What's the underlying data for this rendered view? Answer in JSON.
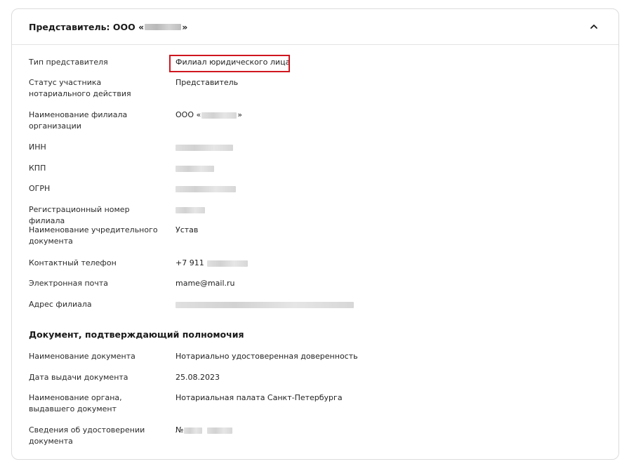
{
  "header": {
    "title_prefix": "Представитель: ООО «",
    "title_suffix": "»",
    "collapse_icon": "chevron-up-icon"
  },
  "representative": {
    "type_label": "Тип представителя",
    "type_value": "Филиал юридического лица",
    "status_label": "Статус участника нотариального действия",
    "status_value": "Представитель",
    "branch_name_label": "Наименование филиала организации",
    "branch_name_prefix": "ООО «",
    "branch_name_suffix": "»",
    "inn_label": "ИНН",
    "kpp_label": "КПП",
    "ogrn_label": "ОГРН",
    "reg_number_label": "Регистрационный номер филиала",
    "founding_doc_label": "Наименование учредительного документа",
    "founding_doc_value": "Устав",
    "phone_label": "Контактный телефон",
    "phone_prefix": "+7 911",
    "email_label": "Электронная почта",
    "email_value": "mame@mail.ru",
    "address_label": "Адрес филиала"
  },
  "authority_document": {
    "section_title": "Документ, подтверждающий полномочия",
    "doc_name_label": "Наименование документа",
    "doc_name_value": "Нотариально удостоверенная доверенность",
    "issue_date_label": "Дата выдачи документа",
    "issue_date_value": "25.08.2023",
    "issuer_label": "Наименование органа, выдавшего документ",
    "issuer_value": "Нотариальная палата Санкт-Петербурга",
    "certification_label": "Сведения об удостоверении документа",
    "certification_prefix": "№"
  },
  "colors": {
    "highlight": "#d0161f",
    "border": "#dcdcdc"
  }
}
